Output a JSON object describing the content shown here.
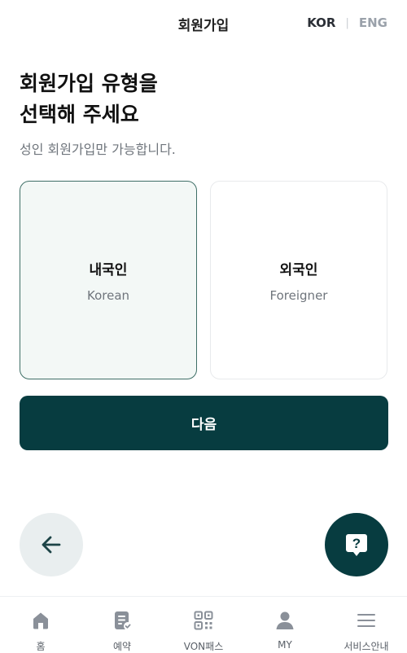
{
  "header": {
    "title": "회원가입",
    "lang_kor": "KOR",
    "lang_separator": "|",
    "lang_eng": "ENG"
  },
  "main": {
    "heading_line1": "회원가입 유형을",
    "heading_line2": "선택해 주세요",
    "subtext": "성인 회원가입만 가능합니다.",
    "options": [
      {
        "title": "내국인",
        "subtitle": "Korean",
        "selected": true
      },
      {
        "title": "외국인",
        "subtitle": "Foreigner",
        "selected": false
      }
    ],
    "next_label": "다음"
  },
  "fab": {
    "back_icon": "arrow-left-icon",
    "help_icon": "question-bubble-icon"
  },
  "tabbar": {
    "items": [
      {
        "label": "홈",
        "icon": "home-icon"
      },
      {
        "label": "예약",
        "icon": "reservation-icon"
      },
      {
        "label": "VON패스",
        "icon": "qr-code-icon"
      },
      {
        "label": "MY",
        "icon": "user-icon"
      },
      {
        "label": "서비스안내",
        "icon": "menu-icon"
      }
    ]
  },
  "colors": {
    "primary": "#073c40",
    "selected_border": "#3f6f67",
    "selected_bg": "#f3f8f6",
    "icon_gray": "#8a9099"
  }
}
